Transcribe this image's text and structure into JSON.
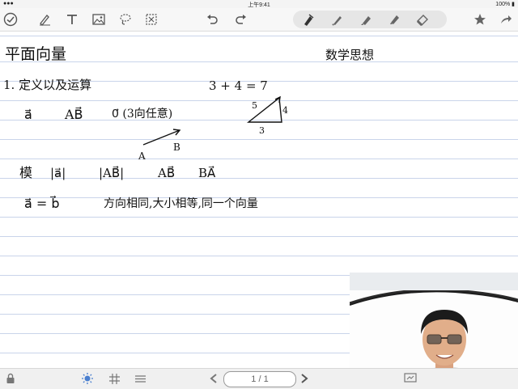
{
  "status_bar": {
    "signal": "●●●",
    "time": "上午9:41",
    "battery": "100%"
  },
  "toolbar": {
    "left_icons": [
      "done-check-icon",
      "pen-icon",
      "text-icon",
      "image-icon",
      "lasso-icon",
      "shapes-icon"
    ],
    "undo_icon": "undo-icon",
    "redo_icon": "redo-icon",
    "tools": [
      "fountain-pen-icon",
      "pen-icon",
      "highlighter-icon",
      "marker-icon",
      "eraser-icon"
    ],
    "right_icons": [
      "star-icon",
      "share-icon"
    ]
  },
  "note": {
    "title": "平面向量",
    "heading_right": "数学思想",
    "line1": "1. 定义以及运算",
    "line2_items": [
      "a⃗",
      "AB⃗",
      "0⃗ (3向任意)"
    ],
    "equation": "3 + 4 = 7",
    "triangle_labels": {
      "hyp": "5",
      "side": "4",
      "base": "3"
    },
    "point_labels": {
      "start": "A",
      "end": "B"
    },
    "line4": [
      "模",
      "|a⃗|",
      "|AB⃗|",
      "AB⃗",
      "BA⃗"
    ],
    "line5_eq": "a⃗ = b⃗",
    "line5_text": "方向相同,大小相等,同一个向量"
  },
  "bottom_bar": {
    "page_indicator": "1 / 1",
    "icons": [
      "lock-icon",
      "brightness-icon",
      "grid-icon",
      "list-icon",
      "prev-page-icon",
      "next-page-icon",
      "presentation-icon"
    ]
  }
}
